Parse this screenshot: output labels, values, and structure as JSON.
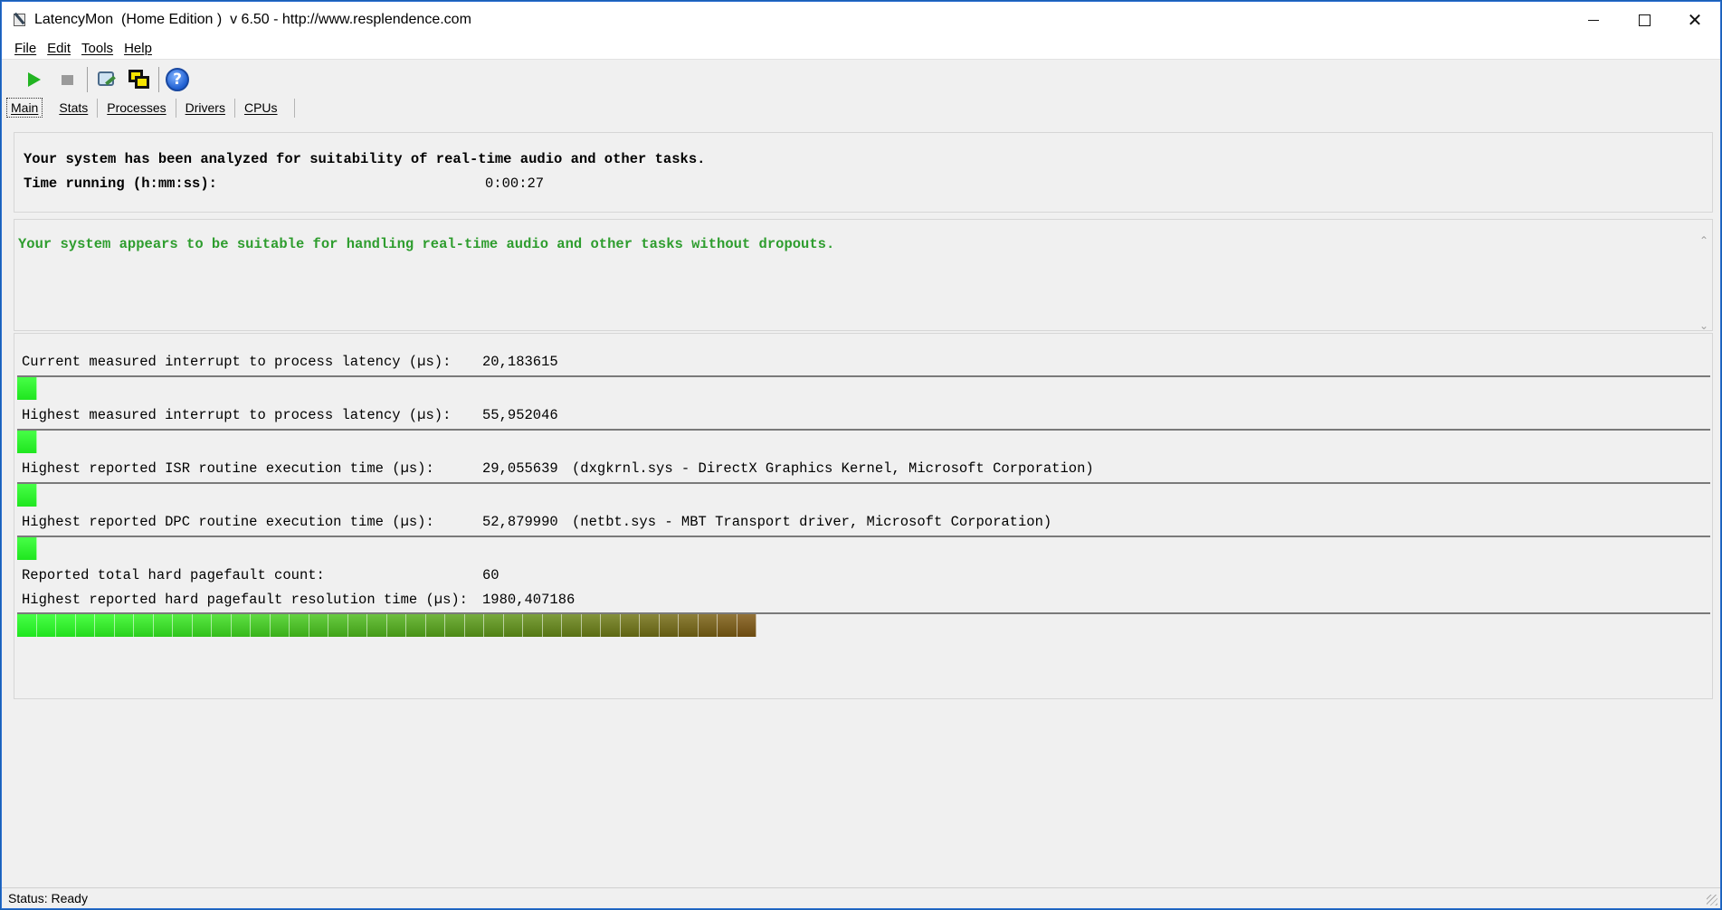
{
  "window": {
    "title": "LatencyMon  (Home Edition )  v 6.50 - http://www.resplendence.com",
    "controls": {
      "minimize_icon": "minimize-icon",
      "maximize_icon": "maximize-icon",
      "close": "✕"
    }
  },
  "menu": {
    "items": [
      "File",
      "Edit",
      "Tools",
      "Help"
    ]
  },
  "toolbar": {
    "icons": [
      "play-icon",
      "stop-icon",
      "tools-icon",
      "windows-icon",
      "help-icon"
    ],
    "help_glyph": "?"
  },
  "tabs": [
    "Main",
    "Stats",
    "Processes",
    "Drivers",
    "CPUs"
  ],
  "summary": {
    "line": "Your system has been analyzed for suitability of real-time audio and other tasks.",
    "time_label": "Time running (h:mm:ss):",
    "time_value": "0:00:27"
  },
  "verdict": {
    "text": "Your system appears to be suitable for handling real-time audio and other tasks without dropouts.",
    "color": "#2e9d2e"
  },
  "metrics": [
    {
      "label": "Current measured interrupt to process latency (µs):",
      "value": "20,183615",
      "detail": "",
      "meter_segments": 1
    },
    {
      "label": "Highest measured interrupt to process latency (µs):",
      "value": "55,952046",
      "detail": "",
      "meter_segments": 1
    },
    {
      "label": "Highest reported ISR routine execution time (µs):",
      "value": "29,055639",
      "detail": "(dxgkrnl.sys - DirectX Graphics Kernel, Microsoft Corporation)",
      "meter_segments": 1
    },
    {
      "label": "Highest reported DPC routine execution time (µs):",
      "value": "52,879990",
      "detail": "(netbt.sys - MBT Transport driver, Microsoft Corporation)",
      "meter_segments": 1
    }
  ],
  "pagefault": {
    "count_label": "Reported total hard pagefault count:",
    "count_value": "60",
    "time_label": "Highest reported hard pagefault resolution time (µs):",
    "time_value": "1980,407186",
    "meter_segments": 38
  },
  "colors": {
    "meter_low": "#1fe61f",
    "meter_high": "#6b4a10"
  },
  "status": {
    "text": "Status: Ready"
  }
}
